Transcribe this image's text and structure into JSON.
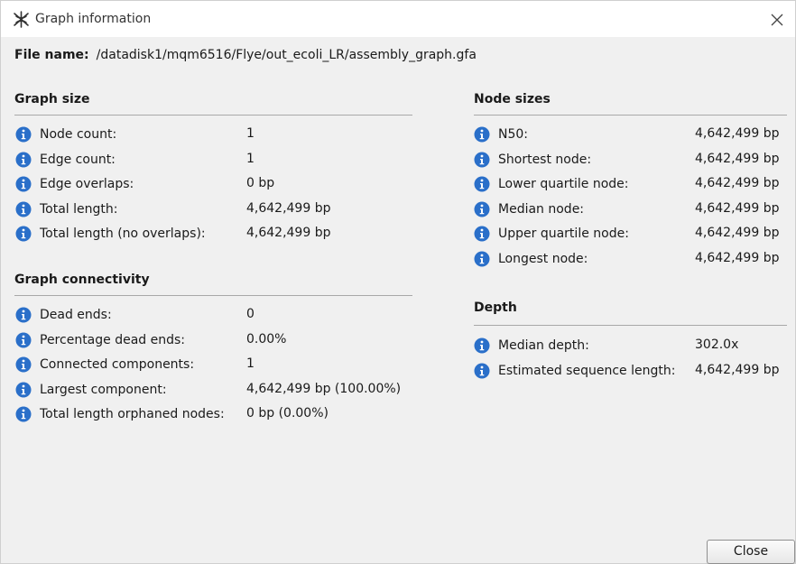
{
  "window": {
    "title": "Graph information",
    "close_icon": "close-icon",
    "app_icon": "bandage-app-icon"
  },
  "file": {
    "label": "File name:",
    "value": "/datadisk1/mqm6516/Flye/out_ecoli_LR/assembly_graph.gfa"
  },
  "graph_size": {
    "title": "Graph size",
    "rows": [
      {
        "label": "Node count:",
        "value": "1"
      },
      {
        "label": "Edge count:",
        "value": "1"
      },
      {
        "label": "Edge overlaps:",
        "value": "0 bp"
      },
      {
        "label": "Total length:",
        "value": "4,642,499 bp"
      },
      {
        "label": "Total length (no overlaps):",
        "value": "4,642,499 bp"
      }
    ]
  },
  "graph_connectivity": {
    "title": "Graph connectivity",
    "rows": [
      {
        "label": "Dead ends:",
        "value": "0"
      },
      {
        "label": "Percentage dead ends:",
        "value": "0.00%"
      },
      {
        "label": "Connected components:",
        "value": "1"
      },
      {
        "label": "Largest component:",
        "value": "4,642,499 bp (100.00%)"
      },
      {
        "label": "Total length orphaned nodes:",
        "value": "0 bp (0.00%)"
      }
    ]
  },
  "node_sizes": {
    "title": "Node sizes",
    "rows": [
      {
        "label": "N50:",
        "value": "4,642,499 bp"
      },
      {
        "label": "Shortest node:",
        "value": "4,642,499 bp"
      },
      {
        "label": "Lower quartile node:",
        "value": "4,642,499 bp"
      },
      {
        "label": "Median node:",
        "value": "4,642,499 bp"
      },
      {
        "label": "Upper quartile node:",
        "value": "4,642,499 bp"
      },
      {
        "label": "Longest node:",
        "value": "4,642,499 bp"
      }
    ]
  },
  "depth": {
    "title": "Depth",
    "rows": [
      {
        "label": "Median depth:",
        "value": "302.0x"
      },
      {
        "label": "Estimated sequence length:",
        "value": "4,642,499 bp"
      }
    ]
  },
  "buttons": {
    "close_label": "Close"
  },
  "colors": {
    "info_icon": "#2a6fc9",
    "divider": "#a8a8a8",
    "dialog_bg": "#f0f0f0"
  }
}
